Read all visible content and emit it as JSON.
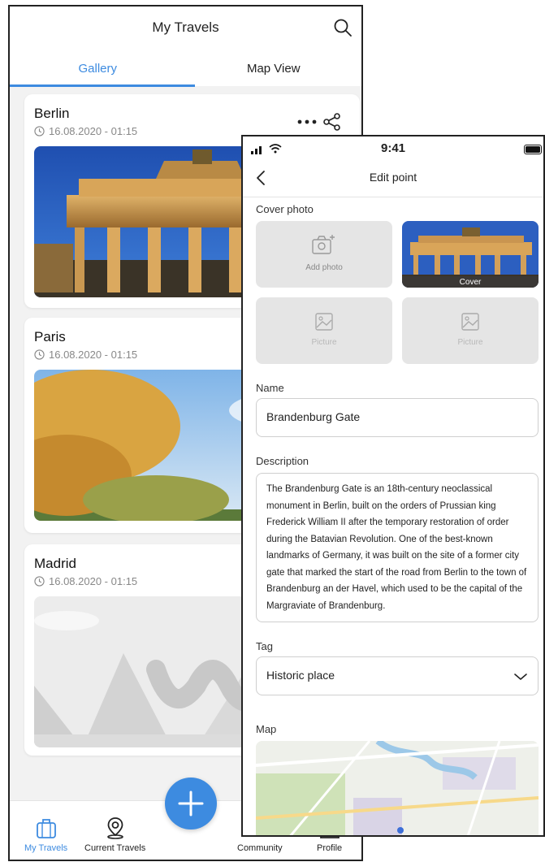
{
  "back_screen": {
    "title": "My Travels",
    "tabs": [
      {
        "label": "Gallery",
        "active": true
      },
      {
        "label": "Map View",
        "active": false
      }
    ],
    "cards": [
      {
        "title": "Berlin",
        "date": "16.08.2020 - 01:15"
      },
      {
        "title": "Paris",
        "date": "16.08.2020 - 01:15"
      },
      {
        "title": "Madrid",
        "date": "16.08.2020 - 01:15"
      }
    ],
    "bottom_nav": [
      {
        "label": "My Travels",
        "icon": "suitcase-icon",
        "active": true
      },
      {
        "label": "Current Travels",
        "icon": "location-pin-icon",
        "active": false
      },
      {
        "label": "Community",
        "icon": "community-icon",
        "active": false
      },
      {
        "label": "Profile",
        "icon": "user-icon",
        "active": false
      }
    ]
  },
  "front_screen": {
    "status_time": "9:41",
    "title": "Edit point",
    "cover_label": "Cover photo",
    "add_photo": "Add photo",
    "cover_caption": "Cover",
    "picture_caption": "Picture",
    "name_label": "Name",
    "name_value": "Brandenburg Gate",
    "description_label": "Description",
    "description_value": "The Brandenburg Gate is an 18th-century neoclassical monument in Berlin, built on the orders of Prussian king Frederick William II after the temporary restoration of order during the Batavian Revolution. One of the best-known landmarks of Germany, it was built on the site of a former city gate that marked the start of the road from Berlin to the town of Brandenburg an der Havel, which used to be the capital of the Margraviate of Brandenburg.",
    "tag_label": "Tag",
    "tag_value": "Historic place",
    "map_label": "Map"
  },
  "colors": {
    "accent": "#3d8be0",
    "background": "#f2f2f2",
    "tile": "#e5e5e5"
  }
}
